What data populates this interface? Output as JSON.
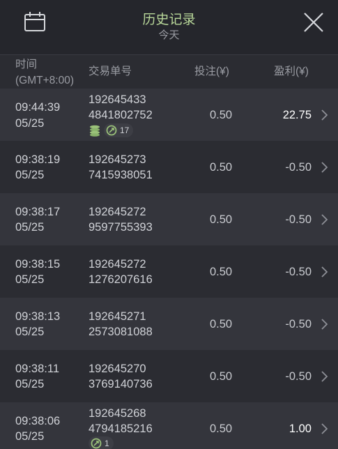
{
  "header": {
    "title": "历史记录",
    "subtitle": "今天"
  },
  "columns": {
    "time": "时间",
    "timezone": "(GMT+8:00)",
    "order": "交易单号",
    "stake": "投注(¥)",
    "profit": "盈利(¥)"
  },
  "rows": [
    {
      "time": "09:44:39",
      "date": "05/25",
      "order_line1": "192645433",
      "order_line2": "4841802752",
      "stake": "0.50",
      "profit": "22.75",
      "badges": {
        "coins": true,
        "free_spins": "17"
      }
    },
    {
      "time": "09:38:19",
      "date": "05/25",
      "order_line1": "192645273",
      "order_line2": "7415938051",
      "stake": "0.50",
      "profit": "-0.50"
    },
    {
      "time": "09:38:17",
      "date": "05/25",
      "order_line1": "192645272",
      "order_line2": "9597755393",
      "stake": "0.50",
      "profit": "-0.50"
    },
    {
      "time": "09:38:15",
      "date": "05/25",
      "order_line1": "192645272",
      "order_line2": "1276207616",
      "stake": "0.50",
      "profit": "-0.50"
    },
    {
      "time": "09:38:13",
      "date": "05/25",
      "order_line1": "192645271",
      "order_line2": "2573081088",
      "stake": "0.50",
      "profit": "-0.50"
    },
    {
      "time": "09:38:11",
      "date": "05/25",
      "order_line1": "192645270",
      "order_line2": "3769140736",
      "stake": "0.50",
      "profit": "-0.50"
    },
    {
      "time": "09:38:06",
      "date": "05/25",
      "order_line1": "192645268",
      "order_line2": "4794185216",
      "stake": "0.50",
      "profit": "1.00",
      "badges": {
        "free_spins": "1"
      }
    }
  ],
  "icons": {
    "calendar": "calendar-icon",
    "close": "close-icon",
    "chevron": "chevron-right-icon",
    "coins": "coins-icon",
    "spin": "free-spin-icon"
  },
  "colors": {
    "title": "#b9d89a",
    "badge_icon": "#9bc27a"
  }
}
